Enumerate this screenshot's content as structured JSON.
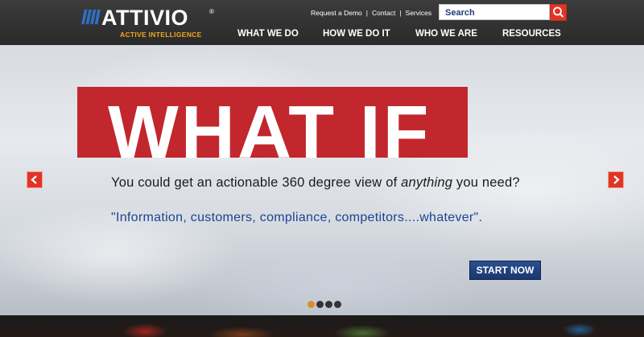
{
  "brand": {
    "name": "ATTIVIO",
    "registered": "®",
    "tagline": "ACTIVE INTELLIGENCE",
    "accent_color": "#f2a81d"
  },
  "utility_links": [
    "Request a Demo",
    "Contact",
    "Services"
  ],
  "search": {
    "placeholder": "Search",
    "button_icon": "search-icon"
  },
  "nav": {
    "items": [
      "WHAT WE DO",
      "HOW WE DO IT",
      "WHO WE ARE",
      "RESOURCES"
    ]
  },
  "hero": {
    "banner_text": "WHAT IF",
    "banner_color": "#c1272d",
    "headline_before": "You could get an actionable 360 degree view of ",
    "headline_emphasis": "anything",
    "headline_after": " you need?",
    "quote": "\"Information, customers, compliance, competitors....whatever\".",
    "cta_label": "START NOW",
    "prev_icon": "chevron-left-icon",
    "next_icon": "chevron-right-icon"
  },
  "carousel": {
    "slide_count": 4,
    "active_index": 0
  }
}
